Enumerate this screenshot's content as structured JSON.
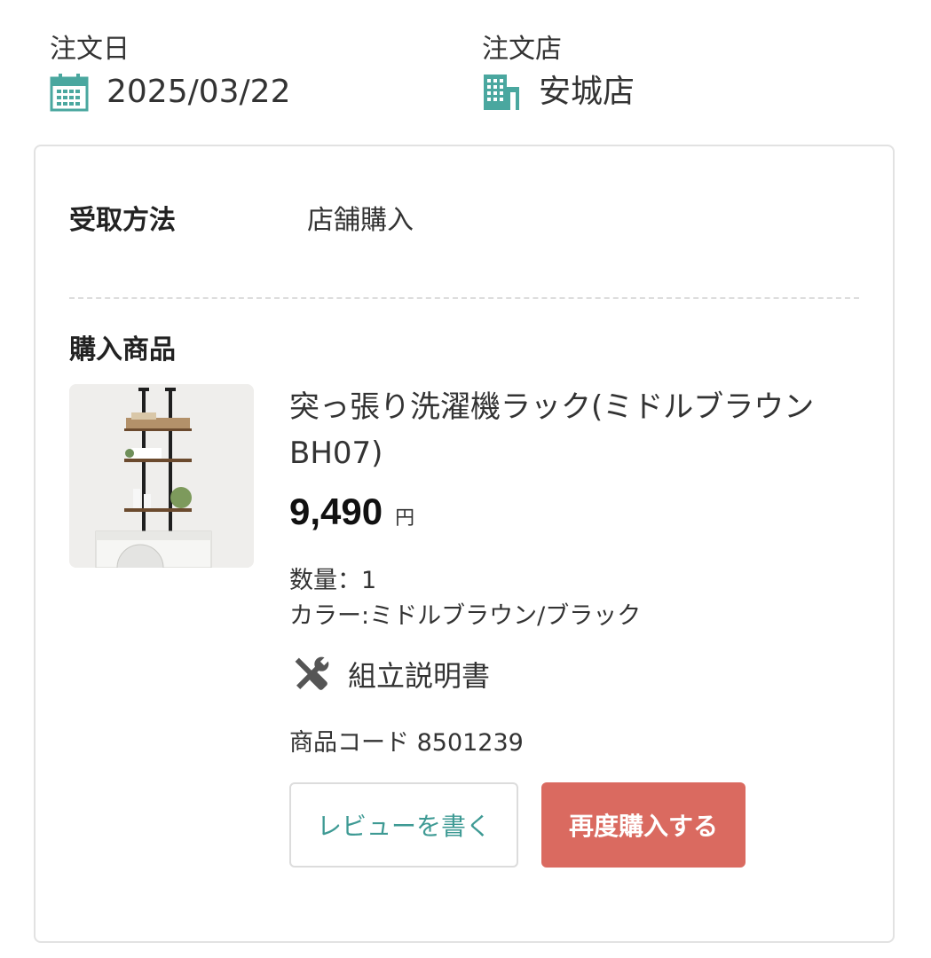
{
  "order": {
    "date_label": "注文日",
    "date_icon": "calendar-icon",
    "date_value": "2025/03/22",
    "store_label": "注文店",
    "store_icon": "building-icon",
    "store_value": "安城店"
  },
  "pickup": {
    "label": "受取方法",
    "value": "店舗購入"
  },
  "purchased": {
    "label": "購入商品",
    "product": {
      "name": "突っ張り洗濯機ラック(ミドルブラウン BH07)",
      "price": "9,490",
      "currency": "円",
      "quantity": "数量：1",
      "color": "カラー:ミドルブラウン/ブラック",
      "manual_icon": "tools-icon",
      "manual_label": "組立説明書",
      "code": "商品コード 8501239"
    }
  },
  "buttons": {
    "review": "レビューを書く",
    "rebuy": "再度購入する"
  },
  "colors": {
    "accent_teal": "#3e9a94",
    "rebuy_red": "#da6a60",
    "icon_teal": "#4aa79f"
  }
}
